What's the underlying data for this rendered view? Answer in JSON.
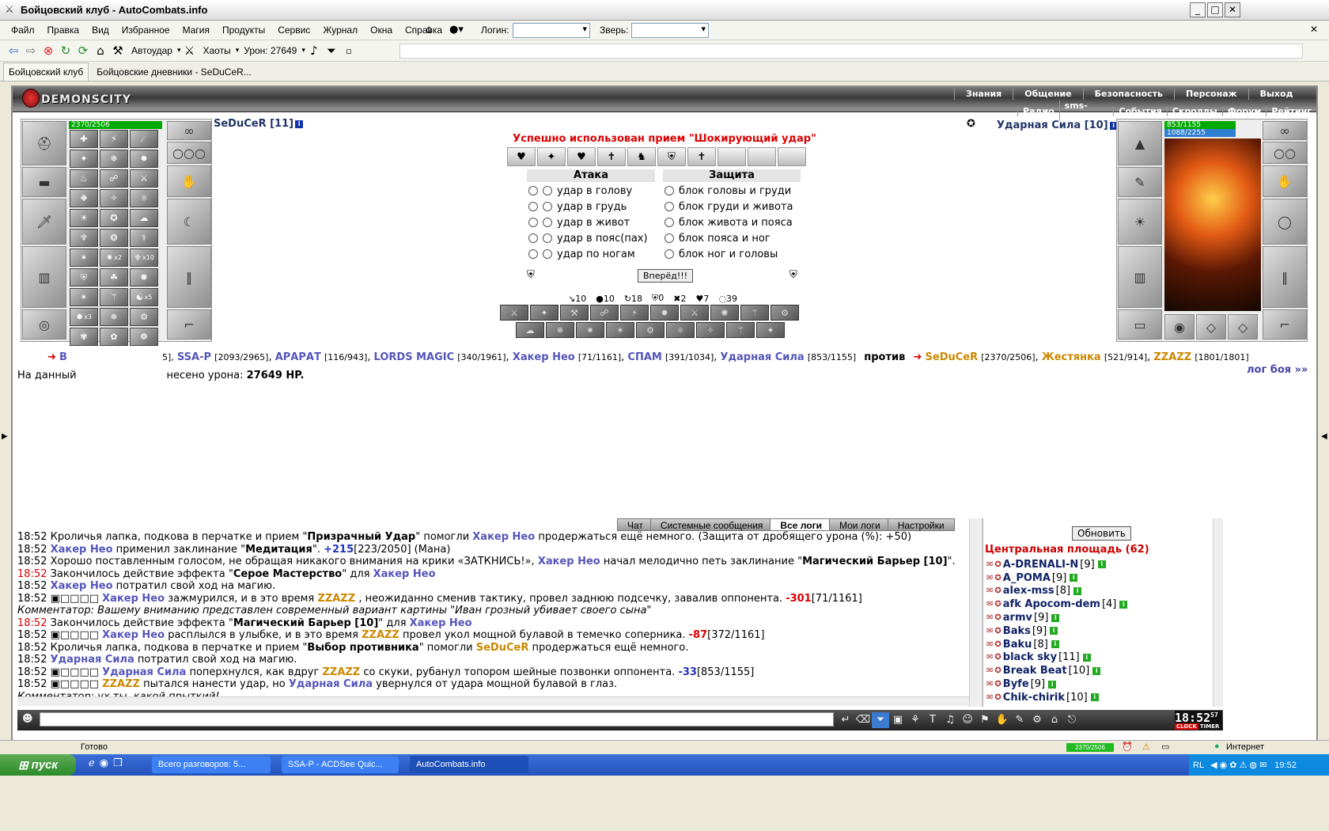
{
  "window": {
    "title": "Бойцовский клуб - AutoCombats.info"
  },
  "menu": [
    "Файл",
    "Правка",
    "Вид",
    "Избранное",
    "Магия",
    "Продукты",
    "Сервис",
    "Журнал",
    "Окна",
    "Справка"
  ],
  "login_label": "Логин:",
  "beast_label": "Зверь:",
  "toolbar": {
    "autoudar": "Автоудар",
    "haoty": "Хаоты",
    "damage": "Урон: 27649"
  },
  "browser_tabs": [
    "Бойцовский клуб",
    "Бойцовские дневники - SeDuCeR..."
  ],
  "game": {
    "logo": "DEMONSCITY",
    "nav_top": [
      "Знания",
      "Общение",
      "Безопасность",
      "Персонаж",
      "Выход"
    ],
    "nav_bottom": [
      "Радио",
      "sms-история",
      "События",
      "Скроллы",
      "Форум",
      "Рейтинг"
    ]
  },
  "player_left": {
    "name": "SeDuCeR [11]",
    "hp": "2370/2506"
  },
  "player_right": {
    "name": "Ударная Сила [10]",
    "hp": "853/1155",
    "mp": "1088/2255"
  },
  "combat": {
    "message": "Успешно использован прием \"Шокирующий удар\"",
    "attack_header": "Атака",
    "defense_header": "Защита",
    "attacks": [
      "удар в голову",
      "удар в грудь",
      "удар в живот",
      "удар в пояс(пах)",
      "удар по ногам"
    ],
    "defenses": [
      "блок головы и груди",
      "блок груди и живота",
      "блок живота и пояса",
      "блок пояса и ног",
      "блок ног и головы"
    ],
    "go_button": "Вперёд!!!",
    "counters": [
      "10",
      "10",
      "18",
      "0",
      "2",
      "7",
      "39"
    ],
    "versus": "против",
    "log_link": "лог боя »»",
    "damage_prefix": "На данный",
    "damage_suffix": "несено урона:",
    "damage_value": "27649 HP."
  },
  "team_left": [
    {
      "name": "SSA-P",
      "hp": "[2093/2965]"
    },
    {
      "name": "АРАРАТ",
      "hp": "[116/943]"
    },
    {
      "name": "LORDS MAGIC",
      "hp": "[340/1961]"
    },
    {
      "name": "Хакер Нео",
      "hp": "[71/1161]"
    },
    {
      "name": "СПАМ",
      "hp": "[391/1034]"
    },
    {
      "name": "Ударная Сила",
      "hp": "[853/1155]"
    }
  ],
  "team_left_partial": {
    "start": "В",
    "end": "5],"
  },
  "team_right": [
    {
      "name": "SeDuCeR",
      "hp": "[2370/2506]"
    },
    {
      "name": "Жестянка",
      "hp": "[521/914]"
    },
    {
      "name": "ZZAZZ",
      "hp": "[1801/1801]"
    }
  ],
  "magic_badges": [
    "x2",
    "x10",
    "x3",
    "x5"
  ],
  "log_tabs": [
    "Чат",
    "Системные сообщения",
    "Все логи",
    "Мои логи",
    "Настройки"
  ],
  "logs": [
    {
      "t": "18:52",
      "parts": [
        [
          "",
          "Кроличья лапка, подкова в перчатке и прием \""
        ],
        [
          "b",
          "Призрачный Удар"
        ],
        [
          "",
          "\" помогли "
        ],
        [
          "n",
          "Хакер Нео"
        ],
        [
          "",
          "продержаться ещё немного. (Защита от дробящего урона (%): +50)"
        ]
      ]
    },
    {
      "t": "18:52",
      "parts": [
        [
          "n",
          "Хакер Нео"
        ],
        [
          "",
          "применил заклинание \""
        ],
        [
          "b",
          "Медитация"
        ],
        [
          "",
          "\". "
        ],
        [
          "h",
          "+215"
        ],
        [
          "",
          "[223/2050] (Мана)"
        ]
      ]
    },
    {
      "t": "18:52",
      "parts": [
        [
          "",
          "Хорошо поставленным голосом, не обращая никакого внимания на крики «ЗАТКНИСЬ!», "
        ],
        [
          "n",
          "Хакер Нео"
        ],
        [
          "",
          "начал мелодично петь заклинание \""
        ],
        [
          "b",
          "Магический Барьер [10]"
        ],
        [
          "",
          "\"."
        ]
      ]
    },
    {
      "t": "18:52",
      "red": true,
      "parts": [
        [
          "",
          "Закончилось действие эффекта \""
        ],
        [
          "b",
          "Серое Мастерство"
        ],
        [
          "",
          "\" для "
        ],
        [
          "n",
          "Хакер Нео"
        ]
      ]
    },
    {
      "t": "18:52",
      "parts": [
        [
          "n",
          "Хакер Нео"
        ],
        [
          "",
          "потратил свой ход на магию."
        ]
      ]
    },
    {
      "t": "18:52",
      "parts": [
        [
          "",
          "▣□□□□ "
        ],
        [
          "n",
          "Хакер Нео"
        ],
        [
          "",
          "зажмурился, и в это время "
        ],
        [
          "o",
          "ZZAZZ"
        ],
        [
          "",
          ", неожиданно сменив тактику, провел заднюю подсечку, завалив оппонента. "
        ],
        [
          "d",
          "-301"
        ],
        [
          "",
          "[71/1161]"
        ]
      ]
    },
    {
      "t": "",
      "parts": [
        [
          "c",
          "Комментатор: Вашему вниманию представлен современный вариант картины \"Иван грозный убивает своего сына\""
        ]
      ]
    },
    {
      "t": "18:52",
      "red": true,
      "parts": [
        [
          "",
          "Закончилось действие эффекта \""
        ],
        [
          "b",
          "Магический Барьер [10]"
        ],
        [
          "",
          "\" для "
        ],
        [
          "n",
          "Хакер Нео"
        ]
      ]
    },
    {
      "t": "18:52",
      "parts": [
        [
          "",
          "▣□□□□ "
        ],
        [
          "n",
          "Хакер Нео"
        ],
        [
          "",
          "расплылся в улыбке, и в это время "
        ],
        [
          "o",
          "ZZAZZ"
        ],
        [
          "",
          "провел укол мощной булавой в темечко соперника. "
        ],
        [
          "d",
          "-87"
        ],
        [
          "",
          "[372/1161]"
        ]
      ]
    },
    {
      "t": "18:52",
      "parts": [
        [
          "",
          "Кроличья лапка, подкова в перчатке и прием \""
        ],
        [
          "b",
          "Выбор противника"
        ],
        [
          "",
          "\" помогли "
        ],
        [
          "o",
          "SeDuCeR"
        ],
        [
          "",
          "продержаться ещё немного."
        ]
      ]
    },
    {
      "t": "18:52",
      "parts": [
        [
          "n",
          "Ударная Сила"
        ],
        [
          "",
          "потратил свой ход на магию."
        ]
      ]
    },
    {
      "t": "18:52",
      "parts": [
        [
          "",
          "▣□□□□ "
        ],
        [
          "n",
          "Ударная Сила"
        ],
        [
          "",
          "поперхнулся, как вдруг "
        ],
        [
          "o",
          "ZZAZZ"
        ],
        [
          "",
          "со скуки, рубанул топором шейные позвонки оппонента. "
        ],
        [
          "h",
          "-33"
        ],
        [
          "",
          "[853/1155]"
        ]
      ]
    },
    {
      "t": "18:52",
      "parts": [
        [
          "",
          "▣□□□□ "
        ],
        [
          "o",
          "ZZAZZ"
        ],
        [
          "",
          "пытался нанести удар, но "
        ],
        [
          "n",
          "Ударная Сила"
        ],
        [
          "",
          "увернулся от удара мощной булавой в глаз."
        ]
      ]
    },
    {
      "t": "",
      "parts": [
        [
          "c",
          "Комментатор: ух ты, какой прыткий!"
        ]
      ]
    }
  ],
  "chat": {
    "refresh_button": "Обновить",
    "room": "Центральная площадь (62)",
    "users": [
      {
        "name": "A-DRENALI-N",
        "lvl": "[9]"
      },
      {
        "name": "A_POMA",
        "lvl": "[9]"
      },
      {
        "name": "alex-mss",
        "lvl": "[8]"
      },
      {
        "name": "afk Apocom-dem",
        "lvl": "[4]"
      },
      {
        "name": "armv",
        "lvl": "[9]"
      },
      {
        "name": "Baks",
        "lvl": "[9]"
      },
      {
        "name": "Baku",
        "lvl": "[8]"
      },
      {
        "name": "black sky",
        "lvl": "[11]"
      },
      {
        "name": "Break Beat",
        "lvl": "[10]"
      },
      {
        "name": "Byfe",
        "lvl": "[9]"
      },
      {
        "name": "Chik-chirik",
        "lvl": "[10]"
      }
    ]
  },
  "clock": {
    "time": "18:52",
    "sec": "57",
    "labels": [
      "CLOCK",
      "TIMER"
    ]
  },
  "status": {
    "ready": "Готово",
    "hp": "2370/2506",
    "zone": "Интернет"
  },
  "taskbar": {
    "start": "пуск",
    "tasks": [
      "Всего разговоров: 5...",
      "SSA-P - ACDSee Quic...",
      "AutoCombats.info"
    ],
    "lang": "RL",
    "time": "19:52"
  }
}
